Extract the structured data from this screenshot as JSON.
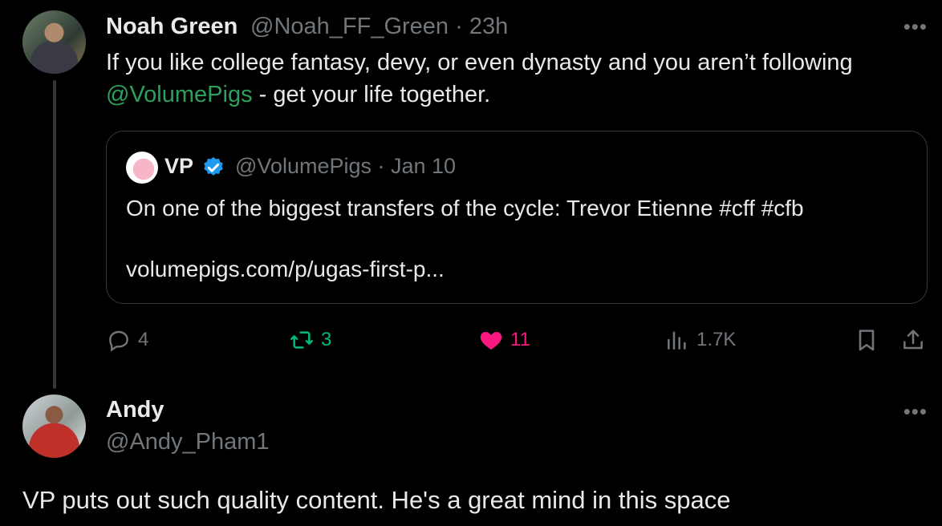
{
  "tweet1": {
    "name": "Noah Green",
    "handle": "@Noah_FF_Green",
    "time": "· 23h",
    "more": "•••",
    "text_pre": "If you like college fantasy, devy, or even dynasty and you aren’t following",
    "mention": "@VolumePigs",
    "text_post": " - get your life together.",
    "quote": {
      "name": "VP",
      "handle": "@VolumePigs · Jan 10",
      "text": "On one of the biggest transfers of the cycle: Trevor Etienne #cff #cfb",
      "link": "volumepigs.com/p/ugas-first-p..."
    },
    "actions": {
      "replies": "4",
      "retweets": "3",
      "likes": "11",
      "views": "1.7K"
    }
  },
  "tweet2": {
    "name": "Andy",
    "handle": "@Andy_Pham1",
    "more": "•••",
    "text": "VP puts out such quality content. He's a great mind in this space"
  },
  "colors": {
    "background": "#000000",
    "text": "#e7e9ea",
    "muted": "#71767b",
    "retweet": "#00ba7c",
    "like": "#f91880",
    "verified": "#1d9bf0",
    "mention": "#2ea05e"
  },
  "icons": [
    "reply-icon",
    "retweet-icon",
    "heart-icon",
    "views-icon",
    "bookmark-icon",
    "share-icon",
    "verified-icon"
  ]
}
